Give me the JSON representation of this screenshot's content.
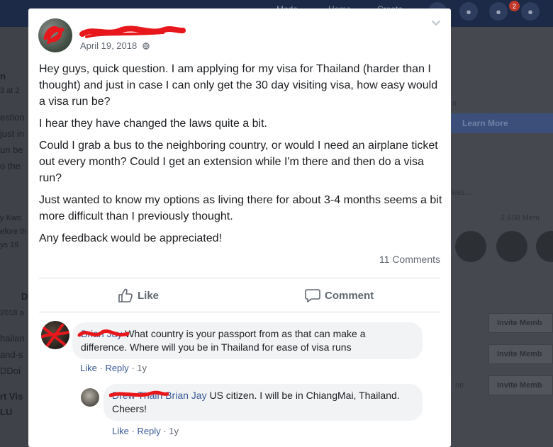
{
  "background": {
    "topbar": {
      "nav": [
        "Moda",
        "Home",
        "Create"
      ],
      "notification_count": "2"
    },
    "left_fragments": [
      "n",
      "3 at 2",
      "estion",
      "just in",
      "un be",
      "o the",
      "y Kwo",
      "efore th",
      "ys 19",
      "D",
      "2018 a",
      "hailan",
      "and-s",
      "DDoi",
      "rt Vis",
      "LU"
    ],
    "right": {
      "learn_more": "Learn More",
      "snippet_s": "s",
      "snippet_less": "less...",
      "members": "2,658 Mem",
      "invite_label": "Invite Memb",
      "snippet_ne": "ne"
    }
  },
  "post": {
    "date": "April 19, 2018",
    "paragraphs": [
      "Hey guys, quick question. I am applying for my visa for Thailand (harder than I thought) and just in case I can only get the 30 day visiting visa, how easy would a visa run be?",
      "I hear they have changed the laws quite a bit.",
      "Could I grab a bus to the neighboring country, or would I need an airplane ticket out every month? Could I get an extension while I'm there and then do a visa run?",
      "Just wanted to know my options as living there for about 3-4 months seems a bit more difficult than I previously thought.",
      "Any feedback would be appreciated!"
    ],
    "comments_count": "11 Comments",
    "like_label": "Like",
    "comment_label": "Comment"
  },
  "comments": [
    {
      "author": "Brian Jay",
      "text": "What country is your passport from as that can make a difference. Where will you be in Thailand for ease of visa runs",
      "like": "Like",
      "reply": "Reply",
      "age": "1y"
    },
    {
      "author_redacted": "Drew Thain",
      "author": "Brian Jay",
      "text": "US citizen. I will be in ChiangMai, Thailand. Cheers!",
      "like": "Like",
      "reply": "Reply",
      "age": "1y"
    }
  ],
  "colors": {
    "link": "#385898",
    "meta": "#606770",
    "bubble": "#f2f3f5",
    "redact": "#e8171b"
  },
  "icons": [
    "globe-icon",
    "chevron-down-icon",
    "thumbs-up-icon",
    "comment-icon"
  ]
}
